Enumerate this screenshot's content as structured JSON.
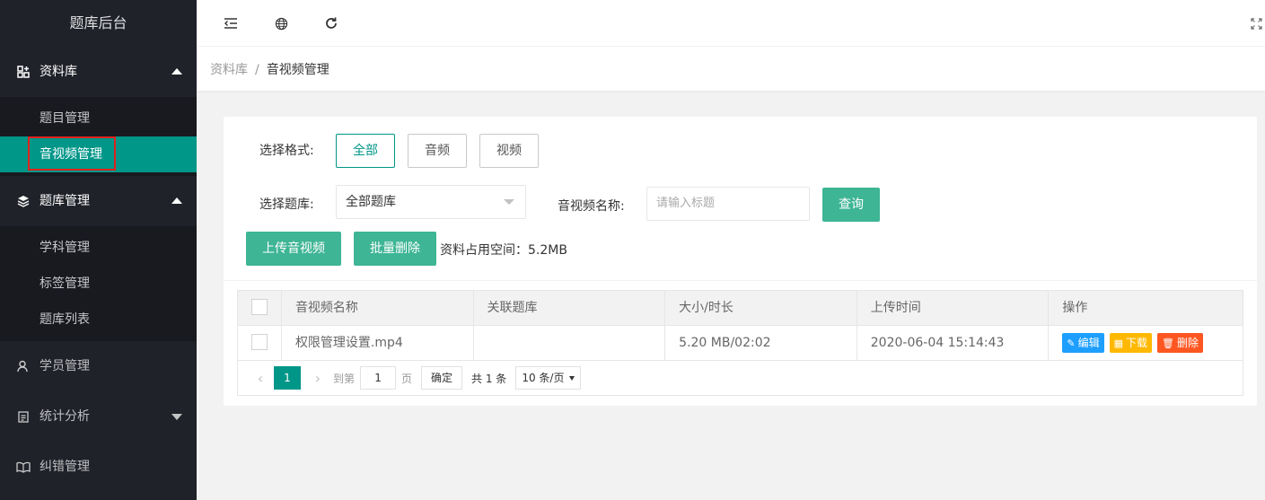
{
  "brand": "题库后台",
  "sidebar": {
    "groups": [
      {
        "label": "资料库",
        "icon": "grid-plus-icon",
        "expanded": true,
        "items": [
          {
            "label": "题目管理"
          },
          {
            "label": "音视频管理",
            "active": true
          }
        ]
      },
      {
        "label": "题库管理",
        "icon": "layers-icon",
        "expanded": true,
        "items": [
          {
            "label": "学科管理"
          },
          {
            "label": "标签管理"
          },
          {
            "label": "题库列表"
          }
        ]
      },
      {
        "label": "学员管理",
        "icon": "user-icon"
      },
      {
        "label": "统计分析",
        "icon": "clipboard-icon",
        "expanded": false
      },
      {
        "label": "纠错管理",
        "icon": "book-icon"
      }
    ]
  },
  "breadcrumb": {
    "parent": "资料库",
    "sep": "/",
    "current": "音视频管理"
  },
  "filters": {
    "format_label": "选择格式:",
    "formats": [
      "全部",
      "音频",
      "视频"
    ],
    "bank_label": "选择题库:",
    "bank_value": "全部题库",
    "name_label": "音视频名称:",
    "name_placeholder": "请输入标题",
    "query_label": "查询"
  },
  "actions": {
    "upload_label": "上传音视频",
    "batch_delete_label": "批量删除",
    "storage_text": "资料占用空间：5.2MB"
  },
  "table": {
    "headers": [
      "音视频名称",
      "关联题库",
      "大小/时长",
      "上传时间",
      "操作"
    ],
    "rows": [
      {
        "name": "权限管理设置.mp4",
        "bank": "",
        "size": "5.20 MB/02:02",
        "time": "2020-06-04 15:14:43"
      }
    ],
    "row_actions": {
      "edit": "编辑",
      "download": "下载",
      "delete": "删除"
    }
  },
  "pager": {
    "current_page": "1",
    "goto_prefix": "到第",
    "goto_value": "1",
    "goto_suffix": "页",
    "confirm": "确定",
    "total": "共 1 条",
    "page_size": "10 条/页"
  },
  "colors": {
    "sidebar_bg": "#20222a",
    "accent": "#009688",
    "button_green": "#3eb595",
    "edit": "#1e9fff",
    "download": "#ffb800",
    "delete": "#ff5722"
  }
}
